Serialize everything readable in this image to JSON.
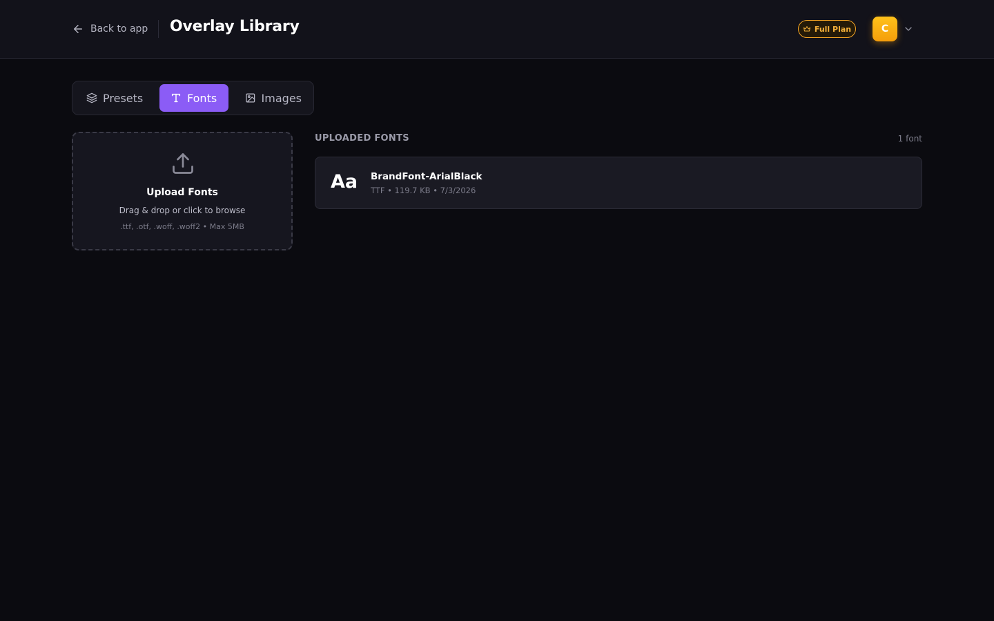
{
  "header": {
    "back_label": "Back to app",
    "title": "Overlay Library",
    "plan_badge": "Full Plan",
    "avatar_initial": "C"
  },
  "tabs": [
    {
      "label": "Presets",
      "icon": "layers-icon",
      "active": false
    },
    {
      "label": "Fonts",
      "icon": "type-icon",
      "active": true
    },
    {
      "label": "Images",
      "icon": "image-icon",
      "active": false
    }
  ],
  "upload": {
    "icon": "upload-icon",
    "title": "Upload Fonts",
    "hint": "Drag & drop or click to browse",
    "formats": ".ttf, .otf, .woff, .woff2 • Max 5MB"
  },
  "fonts_section": {
    "title": "UPLOADED FONTS",
    "count_label": "1 font",
    "items": [
      {
        "preview": "Aa",
        "name": "BrandFont-ArialBlack",
        "meta": "TTF • 119.7 KB • 7/3/2026"
      }
    ]
  },
  "colors": {
    "background": "#0b0b10",
    "header_bg": "#12121a",
    "accent": "#8b5cf6",
    "plan_gold": "#f5a524",
    "avatar": "#fbbf24"
  }
}
